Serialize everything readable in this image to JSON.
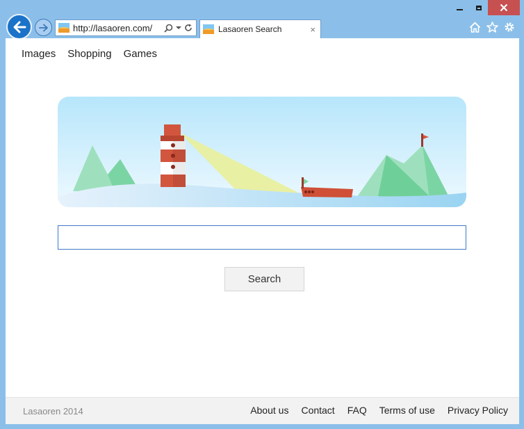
{
  "browser": {
    "address_url": "http://lasaoren.com/",
    "tab_title": "Lasaoren Search",
    "tab_close": "×",
    "icons": [
      "back-arrow-icon",
      "forward-arrow-icon",
      "search-icon",
      "dropdown-icon",
      "refresh-icon",
      "home-icon",
      "star-icon",
      "gear-icon",
      "minimize-icon",
      "maximize-icon",
      "close-icon"
    ]
  },
  "nav": {
    "items": [
      {
        "label": "Images"
      },
      {
        "label": "Shopping"
      },
      {
        "label": "Games"
      }
    ]
  },
  "search": {
    "placeholder": "",
    "value": "",
    "button_label": "Search"
  },
  "footer": {
    "copyright": "Lasaoren 2014",
    "links": [
      {
        "label": "About us"
      },
      {
        "label": "Contact"
      },
      {
        "label": "FAQ"
      },
      {
        "label": "Terms of use"
      },
      {
        "label": "Privacy Policy"
      }
    ]
  },
  "colors": {
    "window_frame": "#8bbfe9",
    "close_button": "#c75050",
    "back_button": "#1a73c9",
    "search_border": "#3e78c5",
    "footer_bg": "#f2f2f2"
  }
}
